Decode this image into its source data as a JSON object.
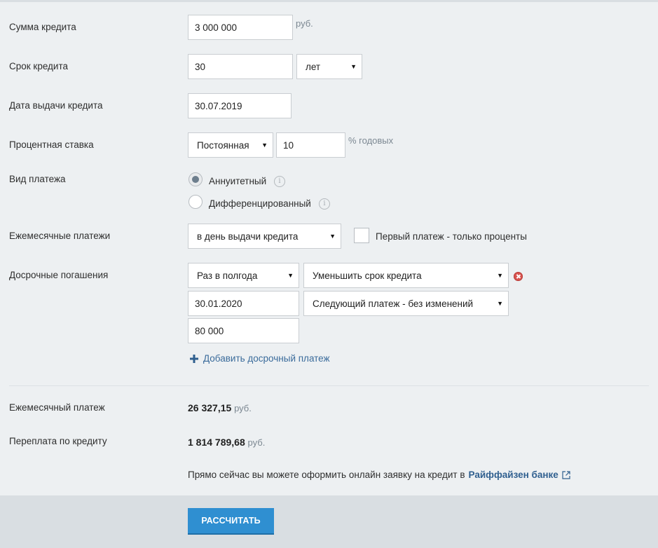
{
  "form": {
    "amount": {
      "label": "Сумма кредита",
      "value": "3 000 000",
      "unit": "руб."
    },
    "term": {
      "label": "Срок кредита",
      "value": "30",
      "unit_select": "лет"
    },
    "issue_date": {
      "label": "Дата выдачи кредита",
      "value": "30.07.2019"
    },
    "rate": {
      "label": "Процентная ставка",
      "type_select": "Постоянная",
      "value": "10",
      "unit": "% годовых"
    },
    "payment_type": {
      "label": "Вид платежа",
      "options": [
        {
          "label": "Аннуитетный",
          "checked": true
        },
        {
          "label": "Дифференцированный",
          "checked": false
        }
      ]
    },
    "monthly": {
      "label": "Ежемесячные платежи",
      "select": "в день выдачи кредита",
      "checkbox_label": "Первый платеж - только проценты"
    },
    "early": {
      "label": "Досрочные погашения",
      "frequency": "Раз в полгода",
      "mode": "Уменьшить срок кредита",
      "date": "30.01.2020",
      "next_payment": "Следующий платеж - без изменений",
      "amount": "80 000",
      "add_label": "Добавить досрочный платеж"
    }
  },
  "results": {
    "monthly_payment": {
      "label": "Ежемесячный платеж",
      "value": "26 327,15",
      "unit": "руб."
    },
    "overpayment": {
      "label": "Переплата по кредиту",
      "value": "1 814 789,68",
      "unit": "руб."
    }
  },
  "promo": {
    "text": "Прямо сейчас вы можете оформить онлайн заявку на кредит в",
    "bank": "Райффайзен банке"
  },
  "calculate_label": "РАССЧИТАТЬ",
  "icons": {
    "dropdown": "chevron-down-icon",
    "info": "info-icon",
    "remove": "remove-icon",
    "add": "plus-icon",
    "external": "external-link-icon"
  },
  "colors": {
    "accent": "#2f8fd1",
    "link": "#3a6b9b",
    "remove": "#d9534f",
    "background": "#edf0f2"
  }
}
